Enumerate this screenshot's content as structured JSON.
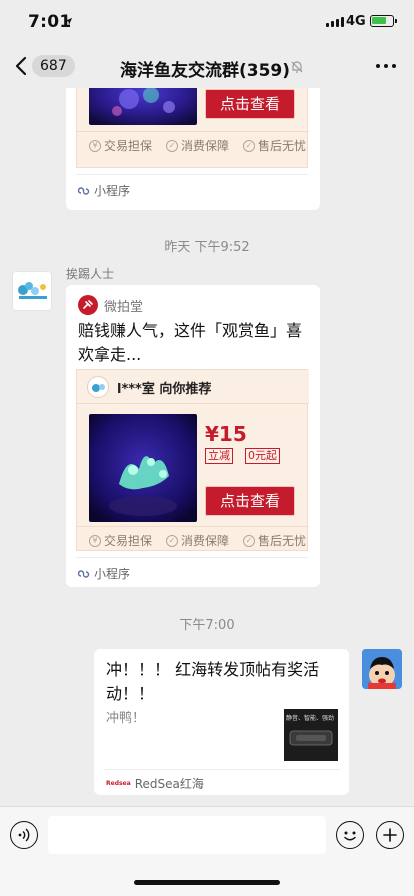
{
  "status": {
    "time": "7:01",
    "network": "4G"
  },
  "nav": {
    "unread": "687",
    "title": "海洋鱼友交流群(359)"
  },
  "card1": {
    "buy_label": "点击查看",
    "guarantees": [
      "交易担保",
      "消费保障",
      "售后无忧"
    ],
    "footer": "小程序"
  },
  "timestamp1": "昨天 下午9:52",
  "message2": {
    "sender": "挨踢人士",
    "app_name": "微拍堂",
    "text": "赔钱赚人气，这件「观赏鱼」喜欢拿走...",
    "shop_label": "l***室 向你推荐",
    "price": "¥15",
    "tag1": "立减",
    "tag2": "0元起",
    "buy_label": "点击查看",
    "guarantees": [
      "交易担保",
      "消费保障",
      "售后无忧"
    ],
    "footer": "小程序"
  },
  "timestamp2": "下午7:00",
  "message3": {
    "title_line1": "冲！！！ 红海转发顶帖有奖活",
    "title_line2": "动！！",
    "desc": "冲鸭！",
    "thumb_text": "静音、智能、强劲",
    "source": "RedSea红海",
    "source_logo": "Redsea"
  },
  "colors": {
    "accent_red": "#c41c2c",
    "card_bg": "#fbefe4",
    "battery": "#3cc24a"
  }
}
